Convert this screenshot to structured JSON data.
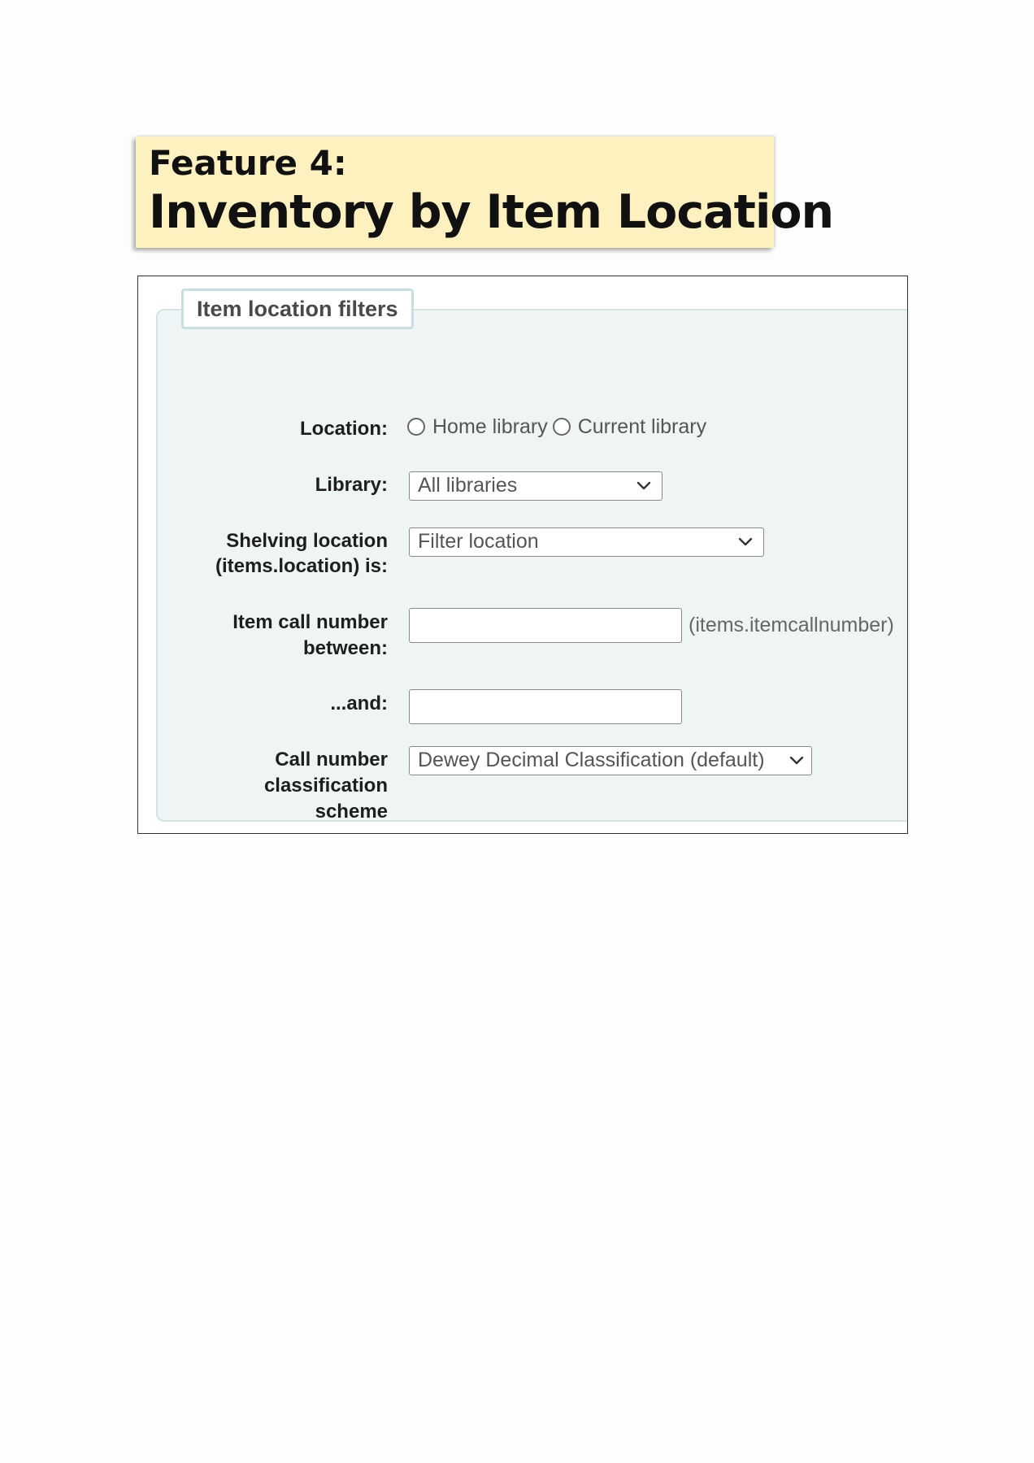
{
  "banner": {
    "kicker": "Feature 4:",
    "headline": "Inventory by Item Location",
    "background": "#fdf2bf"
  },
  "filters": {
    "legend": "Item location filters",
    "location": {
      "label": "Location:",
      "options": [
        "Home library",
        "Current library"
      ]
    },
    "library": {
      "label": "Library:",
      "selected": "All libraries"
    },
    "shelving": {
      "label_line1": "Shelving location",
      "label_line2": "(items.location) is:",
      "selected": "Filter location"
    },
    "callnumber_from": {
      "label_line1": "Item call number",
      "label_line2": "between:",
      "value": "",
      "hint": "(items.itemcallnumber)"
    },
    "callnumber_to": {
      "label": "...and:",
      "value": ""
    },
    "scheme": {
      "label_line1": "Call number",
      "label_line2": "classification",
      "label_line3": "scheme",
      "selected": "Dewey Decimal Classification (default)"
    }
  }
}
